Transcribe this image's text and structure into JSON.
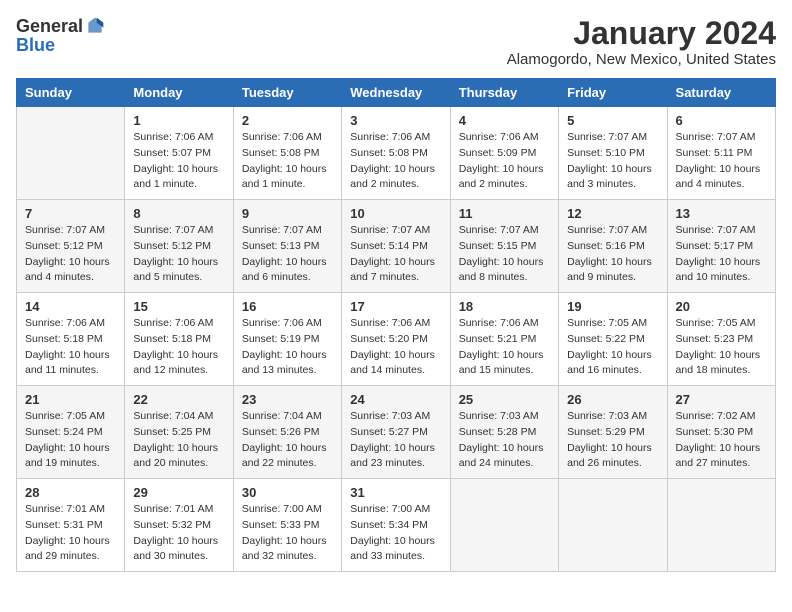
{
  "logo": {
    "text_general": "General",
    "text_blue": "Blue"
  },
  "title": "January 2024",
  "location": "Alamogordo, New Mexico, United States",
  "days_of_week": [
    "Sunday",
    "Monday",
    "Tuesday",
    "Wednesday",
    "Thursday",
    "Friday",
    "Saturday"
  ],
  "weeks": [
    [
      {
        "day": "",
        "info": ""
      },
      {
        "day": "1",
        "info": "Sunrise: 7:06 AM\nSunset: 5:07 PM\nDaylight: 10 hours\nand 1 minute."
      },
      {
        "day": "2",
        "info": "Sunrise: 7:06 AM\nSunset: 5:08 PM\nDaylight: 10 hours\nand 1 minute."
      },
      {
        "day": "3",
        "info": "Sunrise: 7:06 AM\nSunset: 5:08 PM\nDaylight: 10 hours\nand 2 minutes."
      },
      {
        "day": "4",
        "info": "Sunrise: 7:06 AM\nSunset: 5:09 PM\nDaylight: 10 hours\nand 2 minutes."
      },
      {
        "day": "5",
        "info": "Sunrise: 7:07 AM\nSunset: 5:10 PM\nDaylight: 10 hours\nand 3 minutes."
      },
      {
        "day": "6",
        "info": "Sunrise: 7:07 AM\nSunset: 5:11 PM\nDaylight: 10 hours\nand 4 minutes."
      }
    ],
    [
      {
        "day": "7",
        "info": "Sunrise: 7:07 AM\nSunset: 5:12 PM\nDaylight: 10 hours\nand 4 minutes."
      },
      {
        "day": "8",
        "info": "Sunrise: 7:07 AM\nSunset: 5:12 PM\nDaylight: 10 hours\nand 5 minutes."
      },
      {
        "day": "9",
        "info": "Sunrise: 7:07 AM\nSunset: 5:13 PM\nDaylight: 10 hours\nand 6 minutes."
      },
      {
        "day": "10",
        "info": "Sunrise: 7:07 AM\nSunset: 5:14 PM\nDaylight: 10 hours\nand 7 minutes."
      },
      {
        "day": "11",
        "info": "Sunrise: 7:07 AM\nSunset: 5:15 PM\nDaylight: 10 hours\nand 8 minutes."
      },
      {
        "day": "12",
        "info": "Sunrise: 7:07 AM\nSunset: 5:16 PM\nDaylight: 10 hours\nand 9 minutes."
      },
      {
        "day": "13",
        "info": "Sunrise: 7:07 AM\nSunset: 5:17 PM\nDaylight: 10 hours\nand 10 minutes."
      }
    ],
    [
      {
        "day": "14",
        "info": "Sunrise: 7:06 AM\nSunset: 5:18 PM\nDaylight: 10 hours\nand 11 minutes."
      },
      {
        "day": "15",
        "info": "Sunrise: 7:06 AM\nSunset: 5:18 PM\nDaylight: 10 hours\nand 12 minutes."
      },
      {
        "day": "16",
        "info": "Sunrise: 7:06 AM\nSunset: 5:19 PM\nDaylight: 10 hours\nand 13 minutes."
      },
      {
        "day": "17",
        "info": "Sunrise: 7:06 AM\nSunset: 5:20 PM\nDaylight: 10 hours\nand 14 minutes."
      },
      {
        "day": "18",
        "info": "Sunrise: 7:06 AM\nSunset: 5:21 PM\nDaylight: 10 hours\nand 15 minutes."
      },
      {
        "day": "19",
        "info": "Sunrise: 7:05 AM\nSunset: 5:22 PM\nDaylight: 10 hours\nand 16 minutes."
      },
      {
        "day": "20",
        "info": "Sunrise: 7:05 AM\nSunset: 5:23 PM\nDaylight: 10 hours\nand 18 minutes."
      }
    ],
    [
      {
        "day": "21",
        "info": "Sunrise: 7:05 AM\nSunset: 5:24 PM\nDaylight: 10 hours\nand 19 minutes."
      },
      {
        "day": "22",
        "info": "Sunrise: 7:04 AM\nSunset: 5:25 PM\nDaylight: 10 hours\nand 20 minutes."
      },
      {
        "day": "23",
        "info": "Sunrise: 7:04 AM\nSunset: 5:26 PM\nDaylight: 10 hours\nand 22 minutes."
      },
      {
        "day": "24",
        "info": "Sunrise: 7:03 AM\nSunset: 5:27 PM\nDaylight: 10 hours\nand 23 minutes."
      },
      {
        "day": "25",
        "info": "Sunrise: 7:03 AM\nSunset: 5:28 PM\nDaylight: 10 hours\nand 24 minutes."
      },
      {
        "day": "26",
        "info": "Sunrise: 7:03 AM\nSunset: 5:29 PM\nDaylight: 10 hours\nand 26 minutes."
      },
      {
        "day": "27",
        "info": "Sunrise: 7:02 AM\nSunset: 5:30 PM\nDaylight: 10 hours\nand 27 minutes."
      }
    ],
    [
      {
        "day": "28",
        "info": "Sunrise: 7:01 AM\nSunset: 5:31 PM\nDaylight: 10 hours\nand 29 minutes."
      },
      {
        "day": "29",
        "info": "Sunrise: 7:01 AM\nSunset: 5:32 PM\nDaylight: 10 hours\nand 30 minutes."
      },
      {
        "day": "30",
        "info": "Sunrise: 7:00 AM\nSunset: 5:33 PM\nDaylight: 10 hours\nand 32 minutes."
      },
      {
        "day": "31",
        "info": "Sunrise: 7:00 AM\nSunset: 5:34 PM\nDaylight: 10 hours\nand 33 minutes."
      },
      {
        "day": "",
        "info": ""
      },
      {
        "day": "",
        "info": ""
      },
      {
        "day": "",
        "info": ""
      }
    ]
  ]
}
